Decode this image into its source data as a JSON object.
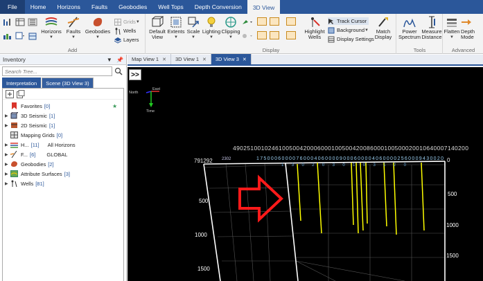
{
  "menubar": {
    "tabs": [
      "File",
      "Home",
      "Horizons",
      "Faults",
      "Geobodies",
      "Well Tops",
      "Depth Conversion",
      "3D View"
    ],
    "active": "3D View"
  },
  "ribbon": {
    "add": {
      "label": "Add",
      "horizons": "Horizons",
      "faults": "Faults",
      "geobodies": "Geobodies",
      "grids": "Grids",
      "wells": "Wells",
      "layers": "Layers"
    },
    "display": {
      "label": "Display",
      "default_view_1": "Default",
      "default_view_2": "View",
      "extents": "Extents",
      "scale": "Scale",
      "lighting": "Lighting",
      "clipping": "Clipping",
      "highlight_1": "Highlight",
      "highlight_2": "Wells",
      "track_cursor": "Track Cursor",
      "background": "Background",
      "display_settings": "Display Settings",
      "match_1": "Match",
      "match_2": "Display"
    },
    "tools": {
      "label": "Tools",
      "power_1": "Power",
      "power_2": "Spectrum",
      "measure_1": "Measure",
      "measure_2": "Distance"
    },
    "advanced": {
      "label": "Advanced",
      "flatten": "Flatten",
      "depth_1": "Depth",
      "depth_2": "Mode"
    }
  },
  "inventory": {
    "title": "Inventory",
    "search_placeholder": "Search Tree...",
    "tabs": [
      "Interpretation",
      "Scene (3D View 3)"
    ],
    "items": [
      {
        "label": "Favorites",
        "count": "[0]"
      },
      {
        "label": "3D Seismic",
        "count": "[1]"
      },
      {
        "label": "2D Seismic",
        "count": "[1]"
      },
      {
        "label": "Mapping Grids",
        "count": "[0]"
      },
      {
        "label": "H...",
        "count": "[11]",
        "extra": "All Horizons"
      },
      {
        "label": "F...",
        "count": "[6]",
        "extra": "GLOBAL"
      },
      {
        "label": "Geobodies",
        "count": "[2]"
      },
      {
        "label": "Attribute Surfaces",
        "count": "[3]"
      },
      {
        "label": "Wells",
        "count": "[81]"
      }
    ]
  },
  "doc_tabs": [
    "Map View 1",
    "3D View 1",
    "3D View 3"
  ],
  "active_doc_tab": "3D View 3",
  "viewport": {
    "expander": ">>",
    "axis_north": "North",
    "axis_east": "East",
    "axis_time": "Time",
    "left_depths": [
      "500",
      "1000",
      "1500"
    ],
    "right_depths": [
      "500",
      "1000",
      "1500"
    ],
    "top_left_label": "791292",
    "top_right_label": "0",
    "header_numbers": "4902510010246100500420006000100500420086000100500020010640007140200",
    "axis_numbers": "1750006000076000406000090006000040600002560009430020",
    "well_labels": "1302030103120",
    "small_labels": "2302"
  },
  "colors": {
    "menubar": "#2b579a",
    "ribbon": "#f3f3f3",
    "viewport_bg": "#000000",
    "well_lines": "#ffff00",
    "arrow": "#ff0000"
  }
}
